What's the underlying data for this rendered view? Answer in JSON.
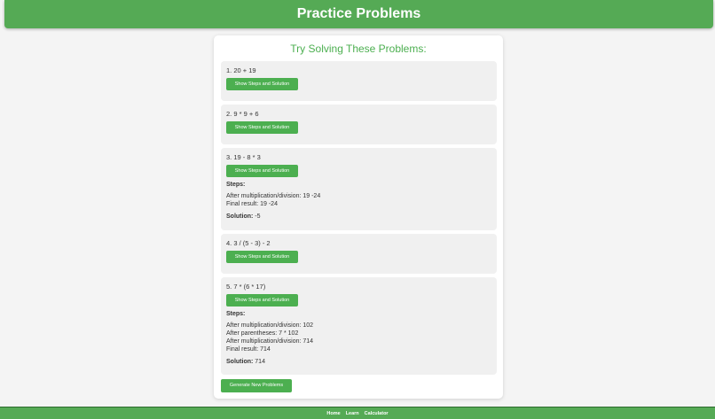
{
  "header": {
    "title": "Practice Problems"
  },
  "card": {
    "title": "Try Solving These Problems:"
  },
  "button_label": "Show Steps and Solution",
  "steps_label": "Steps:",
  "solution_label": "Solution:",
  "problems": [
    {
      "text": "1. 20 + 19"
    },
    {
      "text": "2. 9 * 9 + 6"
    },
    {
      "text": "3. 19 - 8 * 3",
      "steps": [
        "After multiplication/division: 19 -24",
        "Final result: 19 -24"
      ],
      "solution": "-5"
    },
    {
      "text": "4. 3 / (5 - 3) - 2"
    },
    {
      "text": "5. 7 * (6 * 17)",
      "steps": [
        "After multiplication/division: 102",
        "After parentheses: 7 * 102",
        "After multiplication/division: 714",
        "Final result: 714"
      ],
      "solution": "714"
    }
  ],
  "generate_label": "Generate New Problems",
  "footer": {
    "links": [
      "Home",
      "Learn",
      "Calculator"
    ]
  },
  "colors": {
    "primary": "#4caf50",
    "header": "#55aa55"
  }
}
